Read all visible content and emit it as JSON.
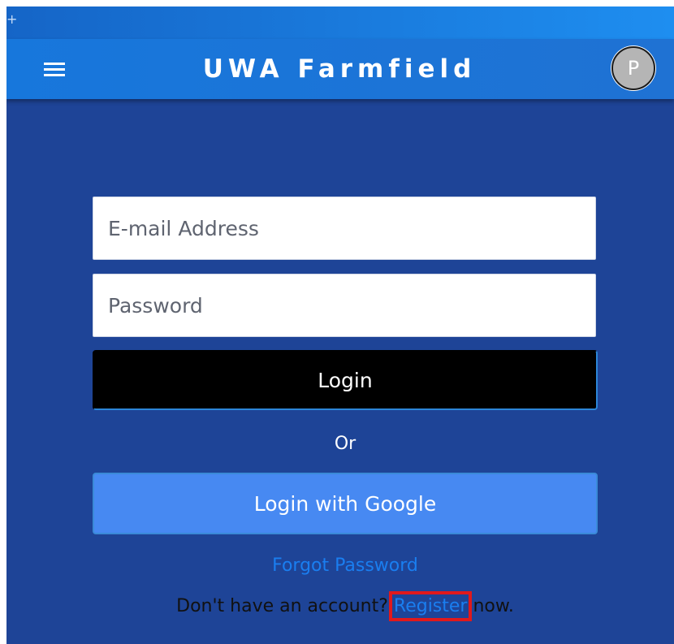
{
  "header": {
    "corner_glyph": "+",
    "title": "UWA Farmfield",
    "avatar_initial": "P"
  },
  "login_form": {
    "email_placeholder": "E-mail Address",
    "password_placeholder": "Password",
    "login_label": "Login",
    "or_label": "Or",
    "google_label": "Login with Google",
    "forgot_password_label": "Forgot Password",
    "register_prefix": "Don't have an account?",
    "register_label": "Register",
    "register_suffix": "now."
  },
  "colors": {
    "page_background": "#1e4497",
    "navbar": "#1777dc",
    "login_button": "#000000",
    "google_button": "#4789f2",
    "link": "#1a7ef0",
    "highlight_box": "#e0191c"
  }
}
